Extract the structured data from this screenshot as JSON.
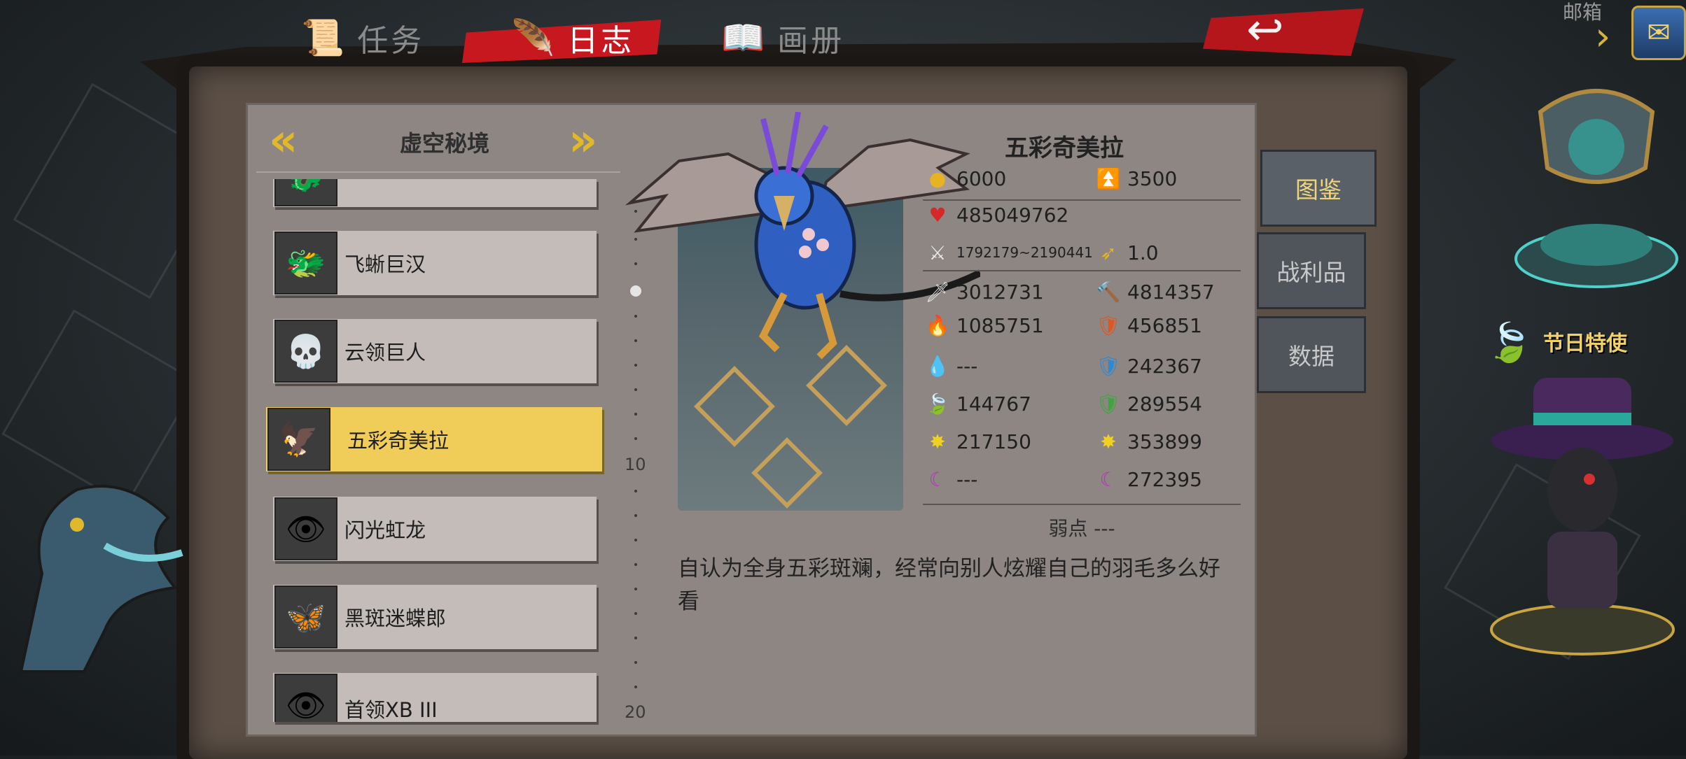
{
  "tabs": [
    {
      "label": "任务",
      "icon": "📜"
    },
    {
      "label": "日志",
      "icon": "🪶"
    },
    {
      "label": "画册",
      "icon": "📖"
    }
  ],
  "mail": {
    "label": "邮箱",
    "icon": "✉"
  },
  "back_icon": "↩",
  "list": {
    "title": "虚空秘境",
    "prev": "«",
    "next": "»",
    "items": [
      {
        "name": "",
        "icon": "🐉"
      },
      {
        "name": "飞蜥巨汉",
        "icon": "🐲"
      },
      {
        "name": "云领巨人",
        "icon": "💀"
      },
      {
        "name": "五彩奇美拉",
        "icon": "🦅"
      },
      {
        "name": "闪光虹龙",
        "icon": "👁"
      },
      {
        "name": "黑斑迷蝶郎",
        "icon": "🦋"
      },
      {
        "name": "首领XB III",
        "icon": "👁"
      }
    ],
    "scroll_numbers": [
      "10",
      "20"
    ]
  },
  "monster": {
    "name": "五彩奇美拉",
    "gold": "6000",
    "exp": "3500",
    "hp": "485049762",
    "attack_range": "1792179~2190441",
    "speed": "1.0",
    "physical_attack": "3012731",
    "physical_defense": "4814357",
    "fire_attack": "1085751",
    "fire_defense": "456851",
    "water_attack": "---",
    "water_defense": "242367",
    "nature_attack": "144767",
    "nature_defense": "289554",
    "light_attack": "217150",
    "light_defense": "353899",
    "dark_attack": "---",
    "dark_defense": "272395",
    "weakness": "弱点 ---",
    "description": "自认为全身五彩斑斓，经常向别人炫耀自己的羽毛多么好看"
  },
  "side_tabs": [
    "图鉴",
    "战利品",
    "数据"
  ],
  "festival": {
    "label": "节日特使",
    "icon": "🍃"
  },
  "colors": {
    "selected": "#f0cc58",
    "accent_red": "#c8181f",
    "gold": "#e0b82c",
    "panel": "#8d8682"
  }
}
